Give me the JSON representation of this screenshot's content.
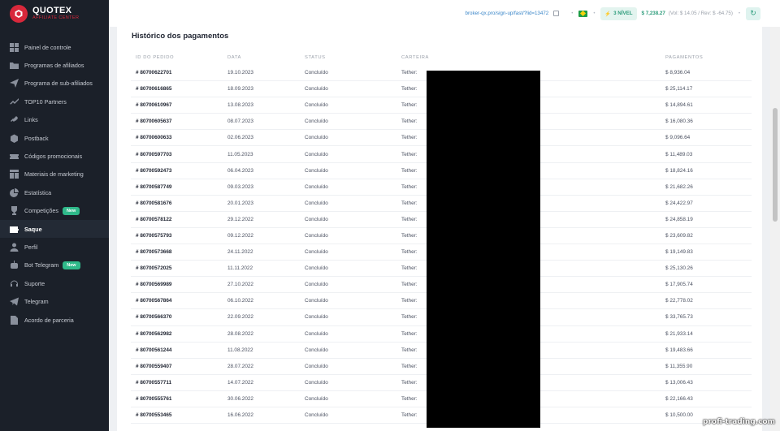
{
  "brand": {
    "title": "QUOTEX",
    "subtitle": "AFFILIATE CENTER"
  },
  "sidebar": {
    "items": [
      {
        "label": "Painel de controle",
        "icon": "dashboard-icon"
      },
      {
        "label": "Programas de afiliados",
        "icon": "folder-icon"
      },
      {
        "label": "Programa de sub-afiliados",
        "icon": "send-icon"
      },
      {
        "label": "TOP10 Partners",
        "icon": "trend-icon"
      },
      {
        "label": "Links",
        "icon": "link-icon"
      },
      {
        "label": "Postback",
        "icon": "box-icon"
      },
      {
        "label": "Códigos promocionais",
        "icon": "ticket-icon"
      },
      {
        "label": "Materiais de marketing",
        "icon": "grid-icon"
      },
      {
        "label": "Estatística",
        "icon": "pie-icon"
      },
      {
        "label": "Competições",
        "icon": "trophy-icon",
        "badge": "New"
      },
      {
        "label": "Saque",
        "icon": "wallet-icon",
        "active": true
      },
      {
        "label": "Perfil",
        "icon": "user-icon"
      },
      {
        "label": "Bot Telegram",
        "icon": "bot-icon",
        "badge": "New"
      },
      {
        "label": "Suporte",
        "icon": "headset-icon"
      },
      {
        "label": "Telegram",
        "icon": "telegram-icon"
      },
      {
        "label": "Acordo de parceria",
        "icon": "document-icon"
      }
    ]
  },
  "topbar": {
    "ref_link": "broker-qx.pro/sign-up/fast/?lid=13472",
    "level": "3 NÍVEL",
    "balance": "$ 7,238.27",
    "balance_detail": "(Vol: $ 14.05 / Rev: $ -64.75)",
    "refresh_icon": "refresh-icon"
  },
  "main": {
    "title": "Histórico dos pagamentos",
    "columns": [
      "ID DO PEDIDO",
      "DATA",
      "STATUS",
      "CARTEIRA",
      "PAGAMENTOS"
    ],
    "rows": [
      {
        "id": "# 80700622701",
        "date": "19.10.2023",
        "status": "Concluído",
        "wallet": "Tether:",
        "amount": "$ 8,936.04"
      },
      {
        "id": "# 80700616865",
        "date": "18.09.2023",
        "status": "Concluído",
        "wallet": "Tether:",
        "amount": "$ 25,114.17"
      },
      {
        "id": "# 80700610967",
        "date": "13.08.2023",
        "status": "Concluído",
        "wallet": "Tether:",
        "amount": "$ 14,894.61"
      },
      {
        "id": "# 80700605637",
        "date": "08.07.2023",
        "status": "Concluído",
        "wallet": "Tether:",
        "amount": "$ 16,080.36"
      },
      {
        "id": "# 80700600633",
        "date": "02.06.2023",
        "status": "Concluído",
        "wallet": "Tether:",
        "amount": "$ 9,096.64"
      },
      {
        "id": "# 80700597703",
        "date": "11.05.2023",
        "status": "Concluído",
        "wallet": "Tether:",
        "amount": "$ 11,489.03"
      },
      {
        "id": "# 80700592473",
        "date": "06.04.2023",
        "status": "Concluído",
        "wallet": "Tether:",
        "amount": "$ 18,824.16"
      },
      {
        "id": "# 80700587749",
        "date": "09.03.2023",
        "status": "Concluído",
        "wallet": "Tether:",
        "amount": "$ 21,682.26"
      },
      {
        "id": "# 80700581676",
        "date": "20.01.2023",
        "status": "Concluído",
        "wallet": "Tether:",
        "amount": "$ 24,422.97"
      },
      {
        "id": "# 80700578122",
        "date": "29.12.2022",
        "status": "Concluído",
        "wallet": "Tether:",
        "amount": "$ 24,858.19"
      },
      {
        "id": "# 80700575793",
        "date": "09.12.2022",
        "status": "Concluído",
        "wallet": "Tether:",
        "amount": "$ 23,609.82"
      },
      {
        "id": "# 80700573668",
        "date": "24.11.2022",
        "status": "Concluído",
        "wallet": "Tether:",
        "amount": "$ 19,149.83"
      },
      {
        "id": "# 80700572025",
        "date": "11.11.2022",
        "status": "Concluído",
        "wallet": "Tether:",
        "amount": "$ 25,130.26"
      },
      {
        "id": "# 80700569989",
        "date": "27.10.2022",
        "status": "Concluído",
        "wallet": "Tether:",
        "amount": "$ 17,905.74"
      },
      {
        "id": "# 80700567864",
        "date": "06.10.2022",
        "status": "Concluído",
        "wallet": "Tether:",
        "amount": "$ 22,778.02"
      },
      {
        "id": "# 80700566370",
        "date": "22.09.2022",
        "status": "Concluído",
        "wallet": "Tether:",
        "amount": "$ 33,765.73"
      },
      {
        "id": "# 80700562982",
        "date": "28.08.2022",
        "status": "Concluído",
        "wallet": "Tether:",
        "amount": "$ 21,933.14"
      },
      {
        "id": "# 80700561244",
        "date": "11.08.2022",
        "status": "Concluído",
        "wallet": "Tether:",
        "amount": "$ 19,483.66"
      },
      {
        "id": "# 80700559407",
        "date": "28.07.2022",
        "status": "Concluído",
        "wallet": "Tether:",
        "amount": "$ 11,355.90"
      },
      {
        "id": "# 80700557711",
        "date": "14.07.2022",
        "status": "Concluído",
        "wallet": "Tether:",
        "amount": "$ 13,006.43"
      },
      {
        "id": "# 80700555761",
        "date": "30.06.2022",
        "status": "Concluído",
        "wallet": "Tether:",
        "amount": "$ 22,166.43"
      },
      {
        "id": "# 80700553465",
        "date": "16.06.2022",
        "status": "Concluído",
        "wallet": "Tether:",
        "amount": "$ 10,500.00"
      }
    ]
  },
  "watermark": "profi-trading.com",
  "colors": {
    "brand_red": "#d8283b",
    "sidebar_bg": "#1b2029",
    "accent_green": "#2b9b7a",
    "badge_green": "#2fb98a",
    "link_blue": "#3a86c8"
  }
}
